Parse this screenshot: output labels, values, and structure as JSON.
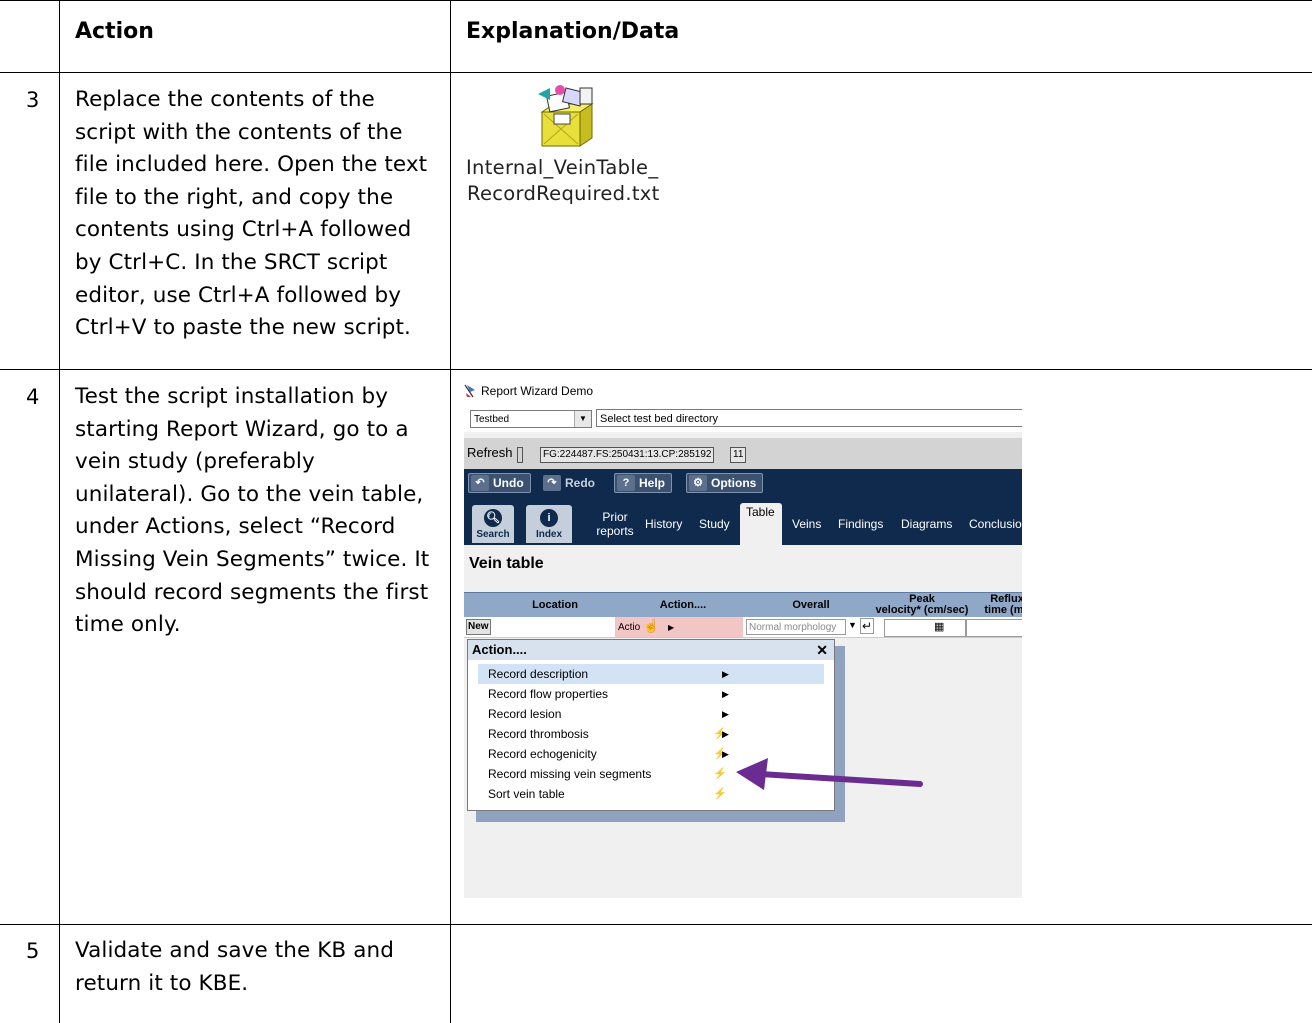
{
  "table": {
    "header": {
      "action": "Action",
      "explanation": "Explanation/Data"
    },
    "rows": [
      {
        "step": "3",
        "action_lines": [
          "Replace the contents of the",
          "script with the contents of the",
          "file included here.  Open the text",
          "file to the right, and copy the",
          "contents using Ctrl+A followed",
          "by Ctrl+C.  In the SRCT script",
          "editor, use Ctrl+A followed by",
          "Ctrl+V to paste the new script."
        ],
        "attachment": {
          "icon": "text-file-package-icon",
          "label_lines": [
            "Internal_VeinTable_",
            "RecordRequired.txt"
          ]
        }
      },
      {
        "step": "4",
        "action_lines": [
          "Test the script installation by",
          "starting Report Wizard, go to a",
          "vein study (preferably",
          "unilateral).  Go to the vein table,",
          "under Actions, select “Record",
          "Missing Vein Segments” twice.  It",
          "should record segments the first",
          "time only."
        ]
      },
      {
        "step": "5",
        "action_lines": [
          "Validate and save the KB and",
          "return it to KBE."
        ]
      }
    ]
  },
  "screenshot": {
    "window_title": "Report Wizard Demo",
    "testbed_select": "Testbed",
    "testbed_dir": "Select test bed directory",
    "refresh": "Refresh",
    "fg_code": "FG:224487.FS:250431:13.CP:285192",
    "fg_count": "11",
    "toolbar": {
      "undo": "Undo",
      "redo": "Redo",
      "help": "Help",
      "options": "Options"
    },
    "nav": {
      "search": "Search",
      "index": "Index",
      "prior_reports_1": "Prior",
      "prior_reports_2": "reports",
      "history": "History",
      "study": "Study",
      "table": "Table",
      "veins": "Veins",
      "findings": "Findings",
      "diagrams": "Diagrams",
      "conclusions": "Conclusio"
    },
    "section_title": "Vein table",
    "grid_headers": {
      "location": "Location",
      "action": "Action....",
      "overall": "Overall",
      "peak_1": "Peak",
      "peak_2": "velocity* (cm/sec)",
      "reflux_1": "Reflux",
      "reflux_2": "time (ms"
    },
    "new_row": {
      "new": "New",
      "action_cell": "Actio",
      "overall_placeholder": "Normal morphology"
    },
    "menu": {
      "title": "Action....",
      "items": [
        "Record description",
        "Record flow properties",
        "Record lesion",
        "Record thrombosis",
        "Record echogenicity",
        "Record missing vein segments",
        "Sort vein table"
      ]
    },
    "colors": {
      "toolbar_bg": "#0f2a4d",
      "arrow": "#6b2c91",
      "grid_header": "#8fa8c7",
      "action_cell": "#f3c6c6"
    }
  }
}
